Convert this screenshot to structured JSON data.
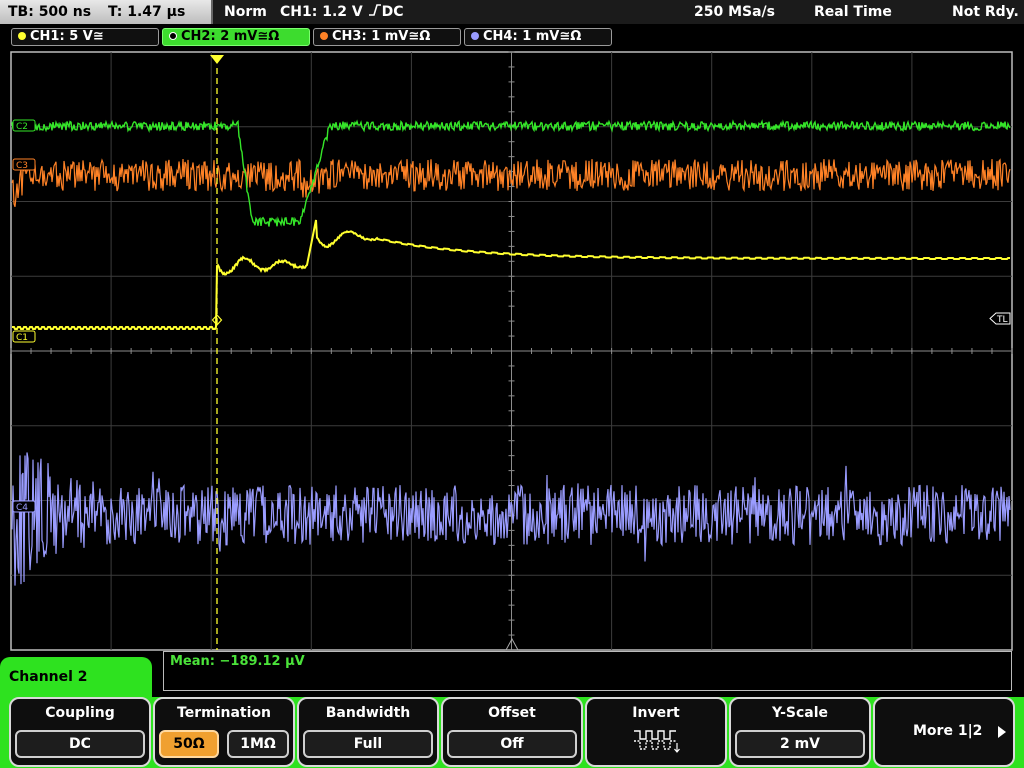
{
  "status": {
    "timebase": "TB: 500 ns",
    "trigger_time": "T: 1.47 µs",
    "trigger_mode": "Norm",
    "trigger_source": "CH1: 1.2 V",
    "trigger_coupling": "DC",
    "sample_rate": "250 MSa/s",
    "acq_mode": "Real Time",
    "state": "Not Rdy."
  },
  "channels": [
    {
      "label": "CH1: 5 V",
      "suffix": "≅",
      "color": "#ffff30"
    },
    {
      "label": "CH2: 2 mV",
      "suffix": "≅Ω",
      "color": "#35e629"
    },
    {
      "label": "CH3: 1 mV",
      "suffix": "≅Ω",
      "color": "#ff8226"
    },
    {
      "label": "CH4: 1 mV",
      "suffix": "≅Ω",
      "color": "#9a9cff"
    }
  ],
  "markers": {
    "c2": "C2",
    "c3": "C3",
    "c1": "C1",
    "c4": "C4",
    "trigger_level": "TL"
  },
  "measurement": {
    "text": "Mean: −189.12 µV"
  },
  "menu": {
    "title": "Channel 2",
    "coupling": {
      "title": "Coupling",
      "value": "DC"
    },
    "termination": {
      "title": "Termination",
      "opt1": "50Ω",
      "opt2": "1MΩ"
    },
    "bandwidth": {
      "title": "Bandwidth",
      "value": "Full"
    },
    "offset": {
      "title": "Offset",
      "value": "Off"
    },
    "invert": {
      "title": "Invert"
    },
    "yscale": {
      "title": "Y-Scale",
      "value": "2 mV"
    },
    "more": {
      "label": "More 1|2"
    }
  },
  "colors": {
    "ch1": "#ffff30",
    "ch2": "#35e629",
    "ch3": "#ff8226",
    "ch4": "#9a9cff",
    "menu_accent": "#2ee21f"
  }
}
